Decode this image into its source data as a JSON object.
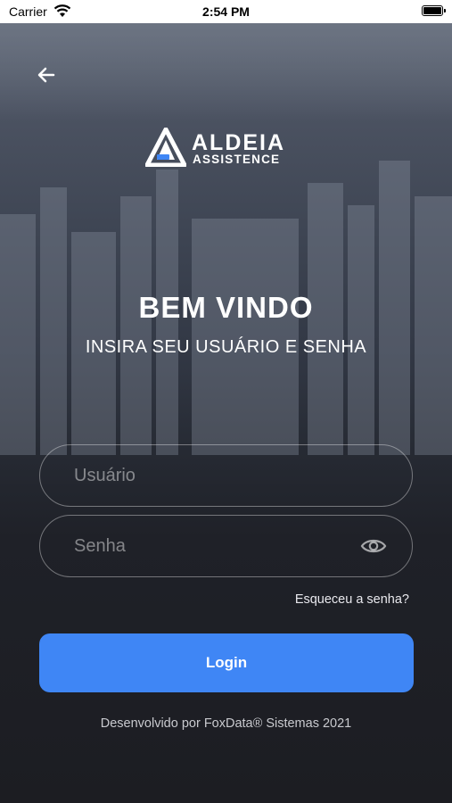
{
  "status_bar": {
    "carrier": "Carrier",
    "time": "2:54 PM"
  },
  "logo": {
    "line1": "ALDEIA",
    "line2": "ASSISTENCE"
  },
  "welcome": {
    "title": "BEM VINDO",
    "subtitle": "INSIRA SEU USUÁRIO E SENHA"
  },
  "form": {
    "username_placeholder": "Usuário",
    "password_placeholder": "Senha",
    "forgot_link": "Esqueceu a senha?",
    "login_button": "Login"
  },
  "footer": "Desenvolvido por FoxData® Sistemas 2021",
  "colors": {
    "accent": "#3f86f5",
    "background": "#1c1d22"
  },
  "icons": [
    "wifi-icon",
    "battery-icon",
    "back-arrow-icon",
    "eye-icon",
    "logo-icon"
  ]
}
